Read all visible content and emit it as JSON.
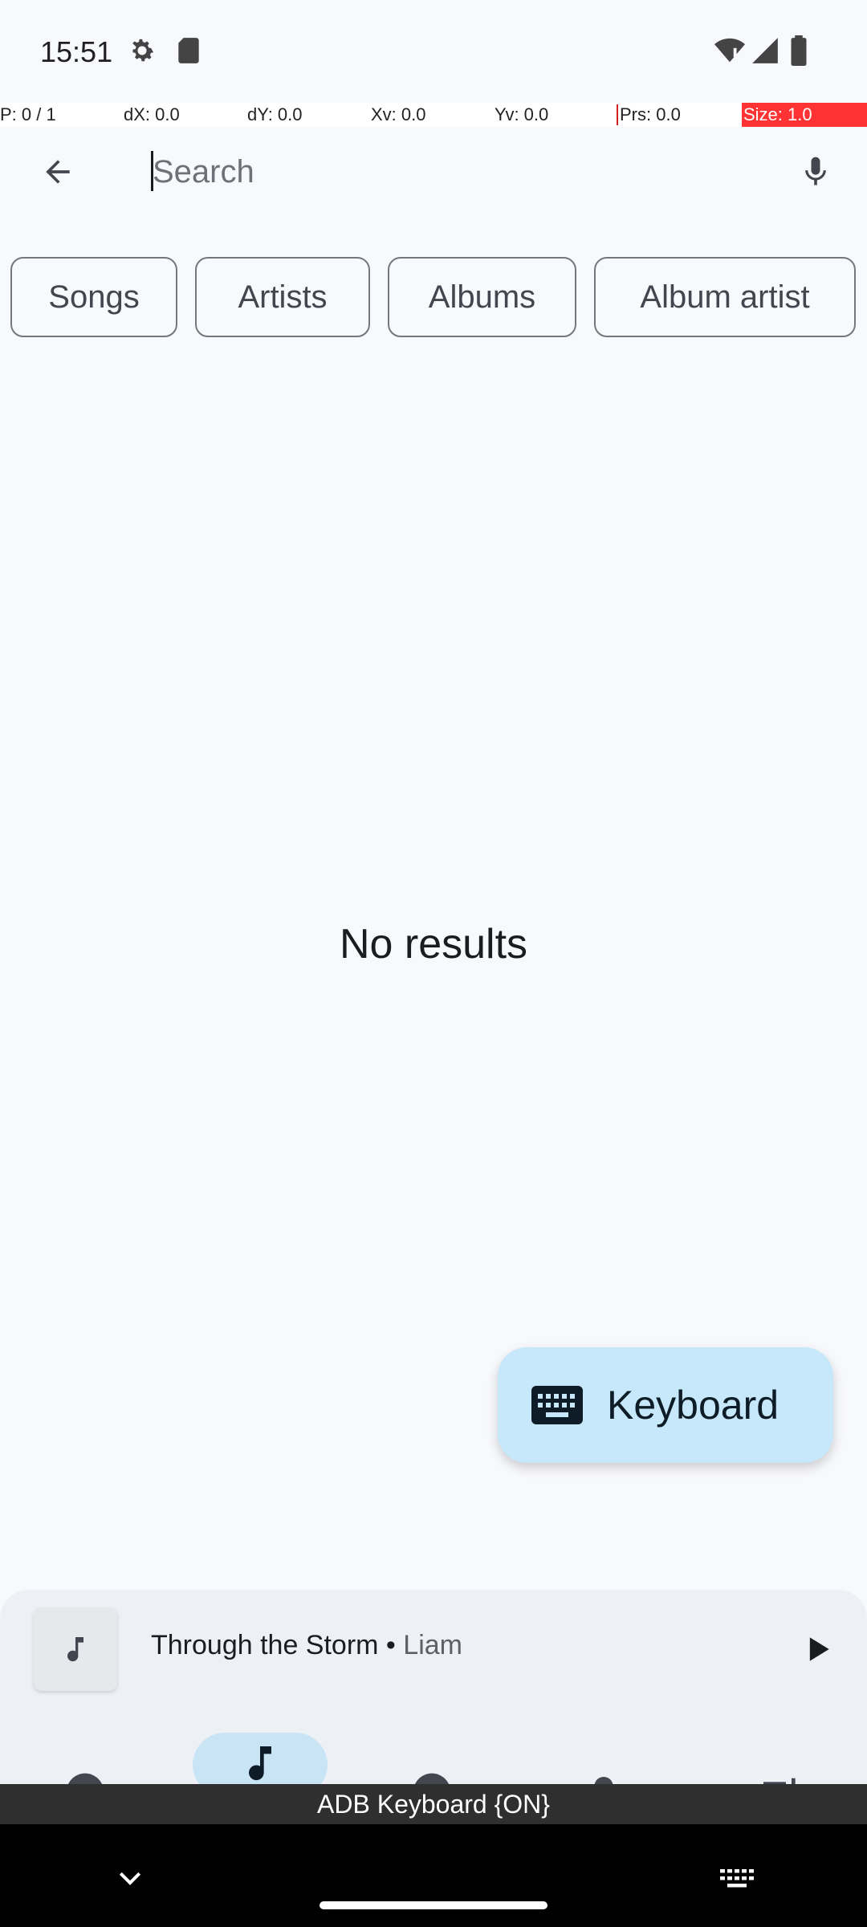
{
  "status_bar": {
    "time": "15:51",
    "left_icons": [
      "gear-icon",
      "sd-card-icon"
    ],
    "right_icons": [
      "wifi-icon",
      "signal-icon",
      "battery-icon"
    ]
  },
  "debug_overlay": {
    "p": "P: 0 / 1",
    "dx": "dX: 0.0",
    "dy": "dY: 0.0",
    "xv": "Xv: 0.0",
    "yv": "Yv: 0.0",
    "prs": "Prs: 0.0",
    "size": "Size: 1.0"
  },
  "toolbar": {
    "back_icon": "arrow-back-icon",
    "search_value": "",
    "search_placeholder": "Search",
    "mic_icon": "mic-icon"
  },
  "filter_chips": [
    {
      "label": "Songs"
    },
    {
      "label": "Artists"
    },
    {
      "label": "Albums"
    },
    {
      "label": "Album artist"
    }
  ],
  "results": {
    "empty_message": "No results"
  },
  "fab": {
    "label": "Keyboard",
    "icon": "keyboard-icon"
  },
  "mini_player": {
    "title": "Through the Storm",
    "separator": " • ",
    "artist": "Liam",
    "art_icon": "music-note-icon",
    "play_icon": "play-icon"
  },
  "bottom_nav": {
    "selected_index": 1,
    "icons": [
      "for-you-icon",
      "songs-icon",
      "albums-icon",
      "artists-icon",
      "playlists-icon"
    ]
  },
  "ime_banner": {
    "text": "ADB Keyboard {ON}"
  },
  "system_nav": {
    "icons": [
      "chevron-down-icon",
      "keyboard-switch-icon"
    ]
  },
  "colors": {
    "background": "#f8f9fc",
    "fab_bg": "#c7e7fa",
    "nav_pill": "#c9e4f4",
    "debug_size_bg": "#ff3333"
  }
}
